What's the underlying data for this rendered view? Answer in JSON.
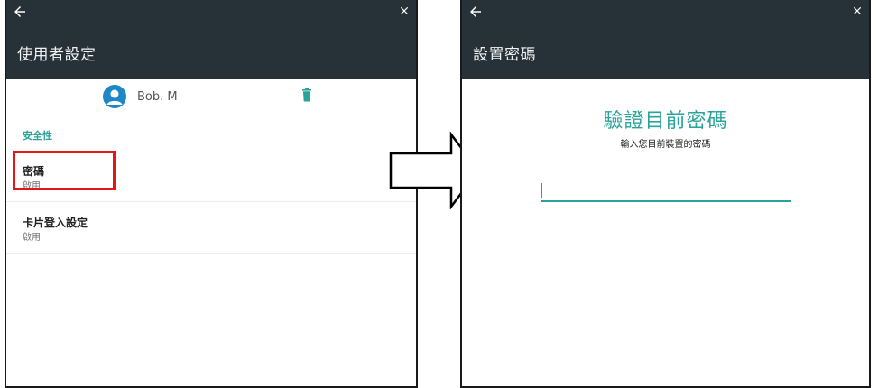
{
  "left_screen": {
    "title": "使用者設定",
    "user": {
      "name": "Bob. M"
    },
    "section_label": "安全性",
    "items": [
      {
        "title": "密碼",
        "status": "啟用"
      },
      {
        "title": "卡片登入設定",
        "status": "啟用"
      }
    ]
  },
  "right_screen": {
    "title": "設置密碼",
    "heading": "驗證目前密碼",
    "subheading": "輸入您目前裝置的密碼",
    "password_value": ""
  },
  "colors": {
    "topbar": "#263238",
    "accent": "#2aa39a",
    "avatar": "#1e88c7",
    "highlight": "#e8141c"
  },
  "icons": [
    "back-arrow-icon",
    "close-icon",
    "person-icon",
    "trash-icon",
    "right-arrow-icon"
  ]
}
